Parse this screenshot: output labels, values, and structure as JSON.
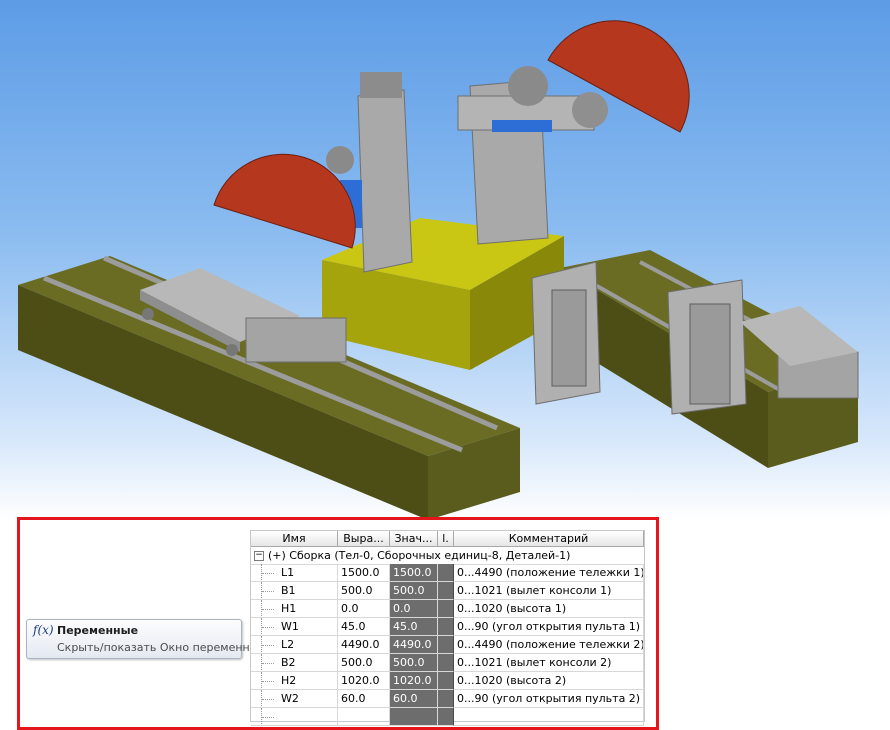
{
  "viewport": {
    "colors": {
      "sky_top": "#5d9ce6",
      "base": "#53551b",
      "pedestal": "#b9b70e",
      "blade": "#b5371e",
      "steel": "#a8a8a8",
      "accent": "#2c6ed5"
    }
  },
  "tooltip": {
    "icon": "fx-icon",
    "title": "Переменные",
    "description": "Скрыть/показать Окно переменных"
  },
  "table": {
    "columns": [
      "Имя",
      "Выра...",
      "Знач...",
      "l.",
      "Комментарий"
    ],
    "group_label": "(+) Сборка (Тел-0, Сборочных единиц-8, Деталей-1)",
    "rows": [
      {
        "name": "L1",
        "expression": "1500.0",
        "value": "1500.0",
        "comment": "0...4490 (положение тележки 1)"
      },
      {
        "name": "B1",
        "expression": "500.0",
        "value": "500.0",
        "comment": "0...1021 (вылет консоли 1)"
      },
      {
        "name": "H1",
        "expression": "0.0",
        "value": "0.0",
        "comment": "0...1020 (высота 1)"
      },
      {
        "name": "W1",
        "expression": "45.0",
        "value": "45.0",
        "comment": "0...90 (угол открытия пульта 1)"
      },
      {
        "name": "L2",
        "expression": "4490.0",
        "value": "4490.0",
        "comment": "0...4490 (положение тележки 2)"
      },
      {
        "name": "B2",
        "expression": "500.0",
        "value": "500.0",
        "comment": "0...1021 (вылет консоли 2)"
      },
      {
        "name": "H2",
        "expression": "1020.0",
        "value": "1020.0",
        "comment": "0...1020 (высота 2)"
      },
      {
        "name": "W2",
        "expression": "60.0",
        "value": "60.0",
        "comment": "0...90 (угол открытия пульта 2)"
      }
    ]
  }
}
